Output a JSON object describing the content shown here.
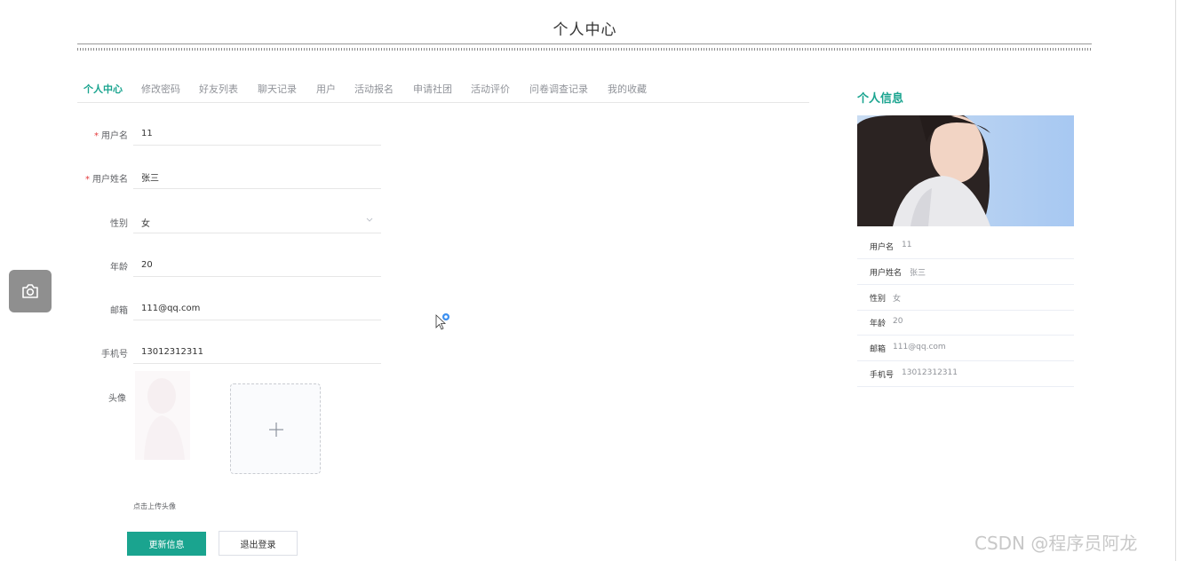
{
  "page": {
    "title": "个人中心"
  },
  "tabs": [
    {
      "label": "个人中心",
      "active": true
    },
    {
      "label": "修改密码"
    },
    {
      "label": "好友列表"
    },
    {
      "label": "聊天记录"
    },
    {
      "label": "用户"
    },
    {
      "label": "活动报名"
    },
    {
      "label": "申请社团"
    },
    {
      "label": "活动评价"
    },
    {
      "label": "问卷调查记录"
    },
    {
      "label": "我的收藏"
    }
  ],
  "form": {
    "username": {
      "label": "用户名",
      "value": "11",
      "required": true
    },
    "realname": {
      "label": "用户姓名",
      "value": "张三",
      "required": true
    },
    "gender": {
      "label": "性别",
      "value": "女"
    },
    "age": {
      "label": "年龄",
      "value": "20"
    },
    "email": {
      "label": "邮箱",
      "value": "111@qq.com"
    },
    "phone": {
      "label": "手机号",
      "value": "13012312311"
    },
    "avatar": {
      "label": "头像",
      "hint": "点击上传头像"
    }
  },
  "buttons": {
    "update": "更新信息",
    "logout": "退出登录"
  },
  "side": {
    "title": "个人信息",
    "rows": [
      {
        "key": "用户名",
        "value": "11"
      },
      {
        "key": "用户姓名",
        "value": "张三"
      },
      {
        "key": "性别",
        "value": "女"
      },
      {
        "key": "年龄",
        "value": "20"
      },
      {
        "key": "邮箱",
        "value": "111@qq.com"
      },
      {
        "key": "手机号",
        "value": "13012312311"
      }
    ]
  },
  "watermark": "CSDN @程序员阿龙",
  "colors": {
    "accent": "#1aa48f",
    "required": "#e4393c",
    "muted": "#909399"
  },
  "icons": {
    "camera": "camera-icon",
    "upload": "plus-icon",
    "select": "chevron-down-icon"
  }
}
